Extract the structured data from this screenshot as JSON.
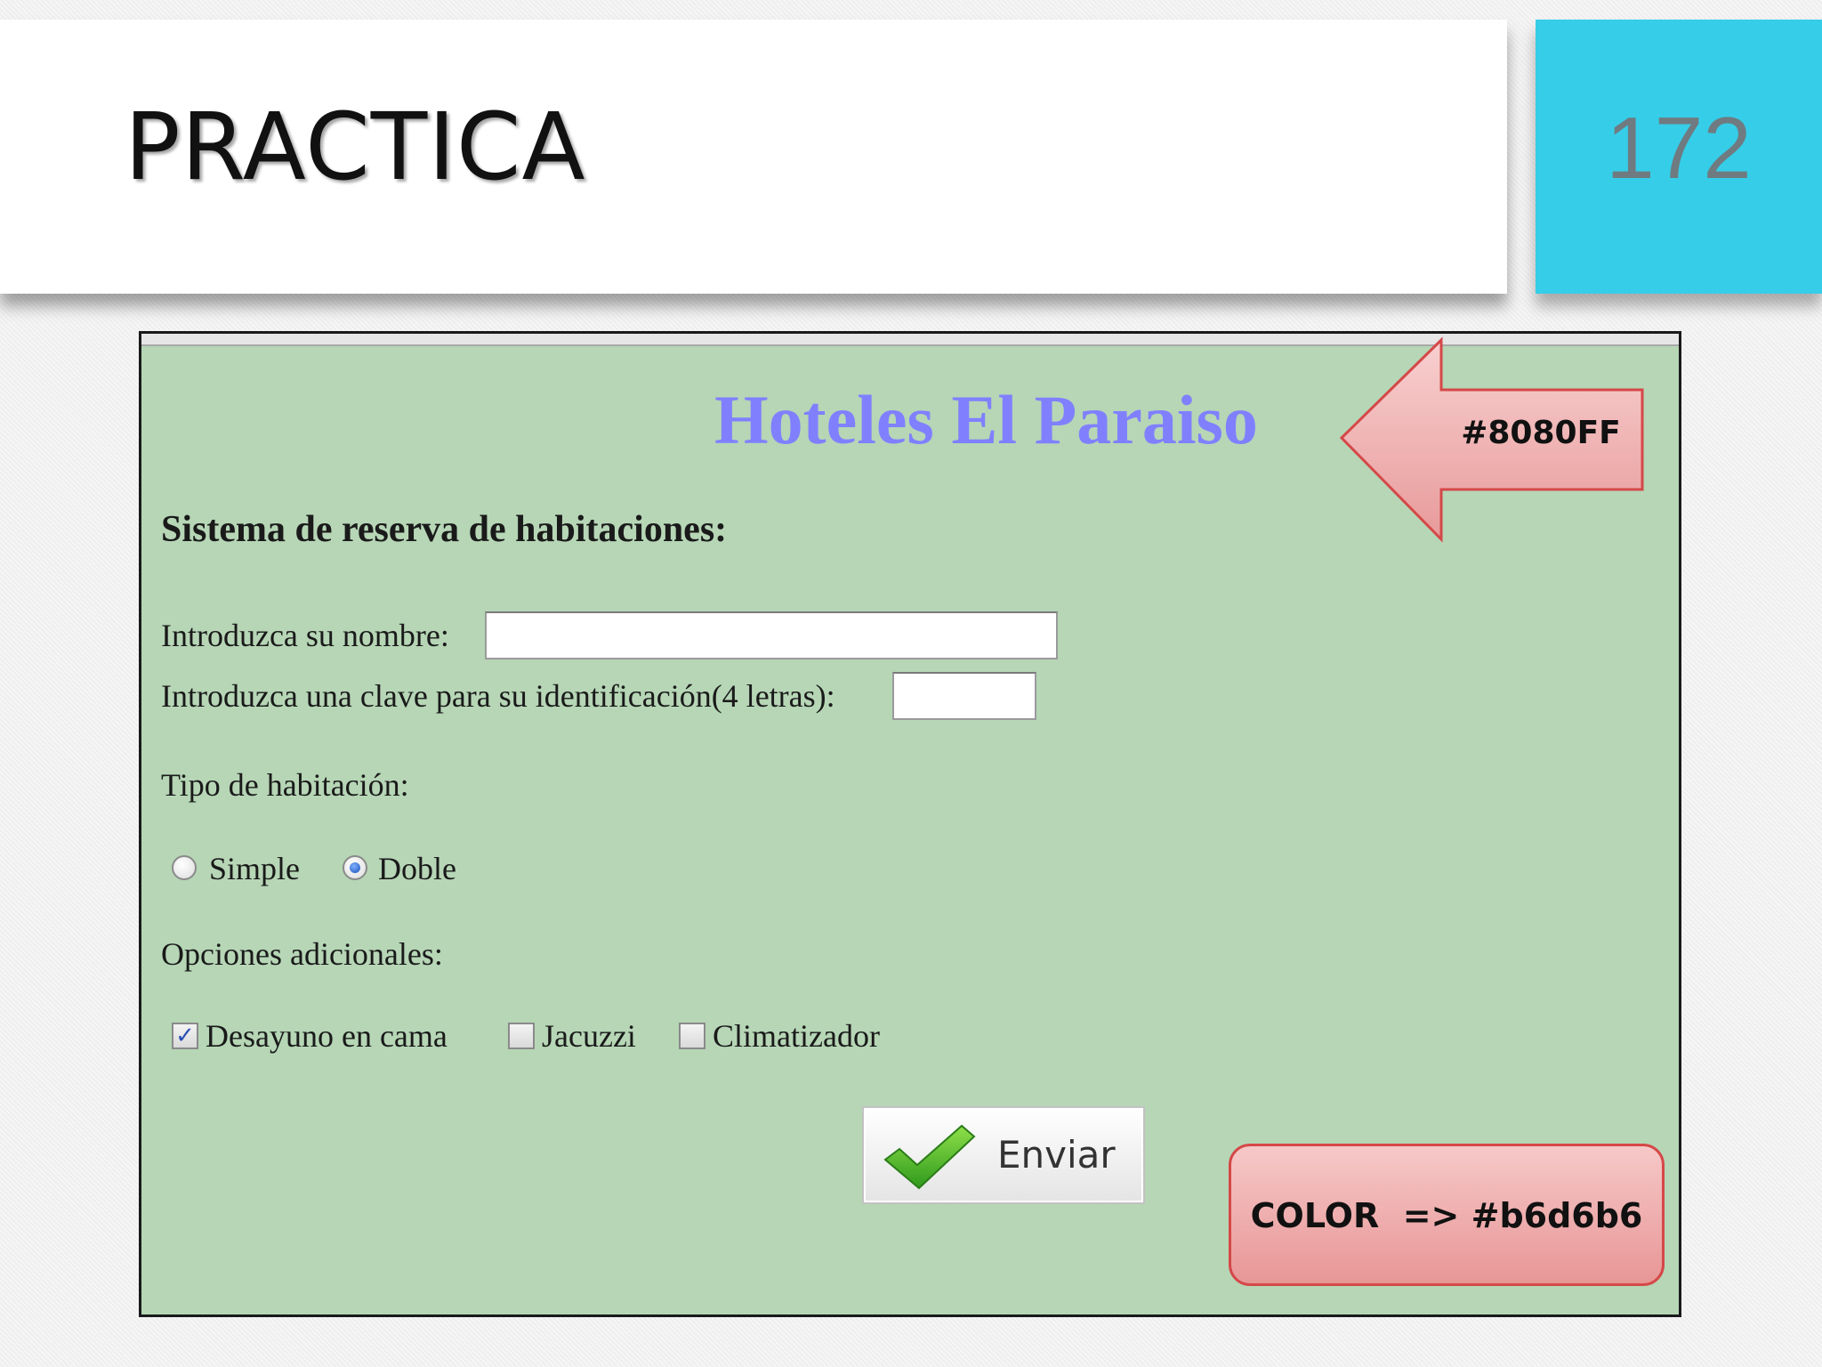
{
  "slide": {
    "title": "PRACTICA",
    "number": "172",
    "accent_color": "#36cde8"
  },
  "form": {
    "background_color": "#b6d6b6",
    "hotel_title": "Hoteles El Paraiso",
    "hotel_title_color": "#8080ff",
    "subheading": "Sistema de reserva de habitaciones:",
    "name_label": "Introduzca su nombre:",
    "name_value": "",
    "key_label": "Introduzca una clave para su identificación(4 letras):",
    "key_value": "",
    "room_type_label": "Tipo de habitación:",
    "room_options": [
      {
        "label": "Simple",
        "selected": false
      },
      {
        "label": "Doble",
        "selected": true
      }
    ],
    "extras_label": "Opciones adicionales:",
    "extras": [
      {
        "label": "Desayuno en cama",
        "checked": true
      },
      {
        "label": "Jacuzzi",
        "checked": false
      },
      {
        "label": "Climatizador",
        "checked": false
      }
    ],
    "submit_label": "Enviar",
    "submit_icon": "green-checkmark-icon"
  },
  "annotations": {
    "arrow_text": "#8080FF",
    "color_note": "COLOR  => #b6d6b6",
    "callout_color": "#e89696"
  }
}
